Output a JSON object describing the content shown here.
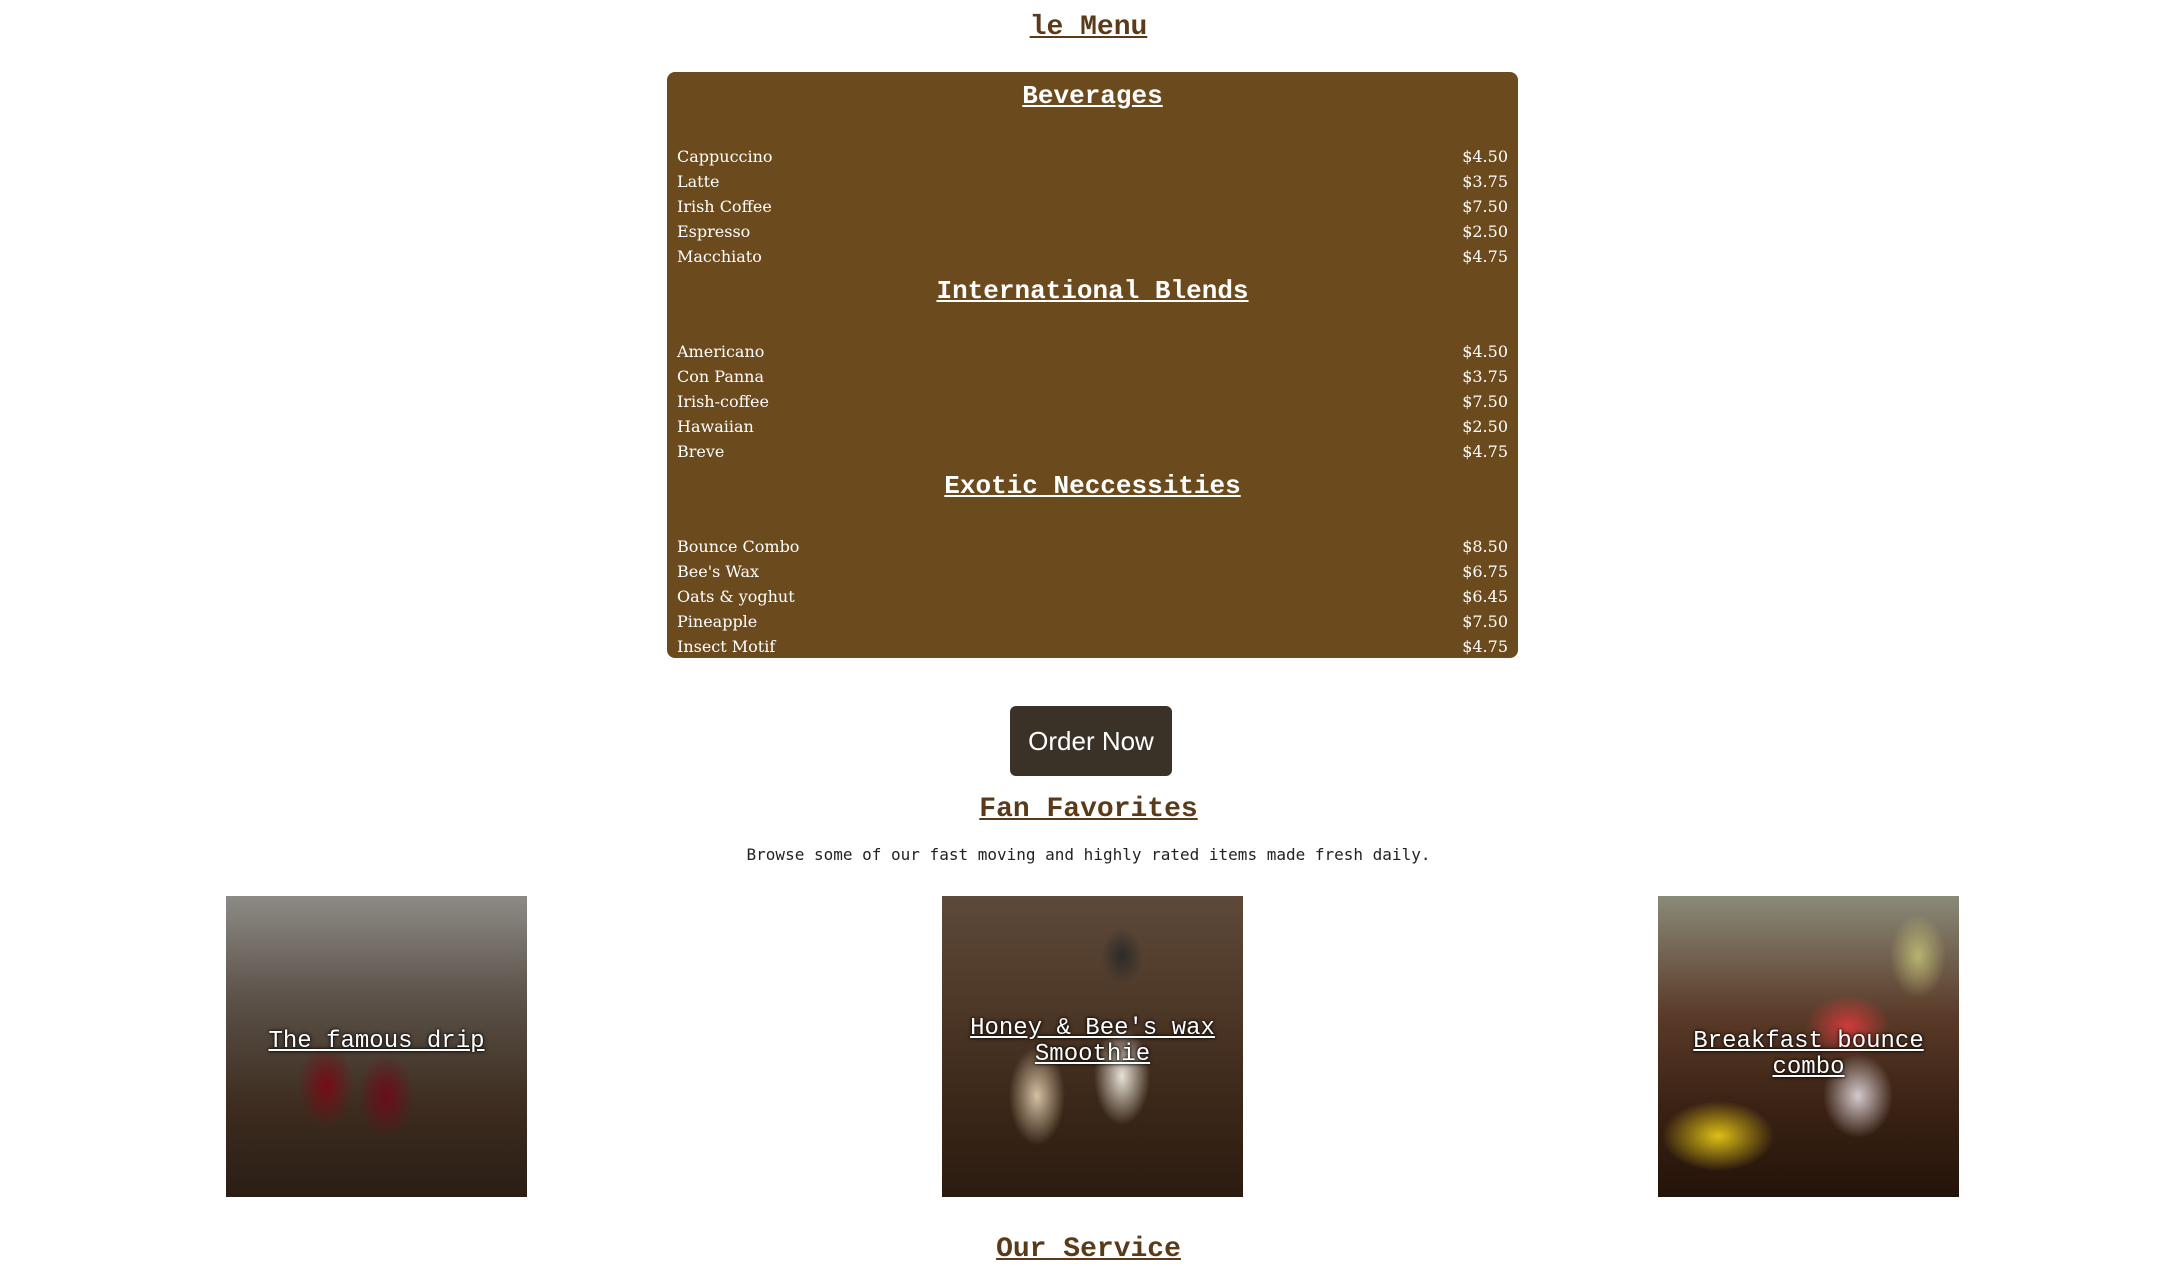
{
  "menu": {
    "heading": "le Menu",
    "categories": [
      {
        "title": "Beverages",
        "items": [
          {
            "name": "Cappuccino",
            "price": "$4.50"
          },
          {
            "name": "Latte",
            "price": "$3.75"
          },
          {
            "name": "Irish Coffee",
            "price": "$7.50"
          },
          {
            "name": "Espresso",
            "price": "$2.50"
          },
          {
            "name": "Macchiato",
            "price": "$4.75"
          }
        ]
      },
      {
        "title": "International Blends",
        "items": [
          {
            "name": "Americano",
            "price": "$4.50"
          },
          {
            "name": "Con Panna",
            "price": "$3.75"
          },
          {
            "name": "Irish-coffee",
            "price": "$7.50"
          },
          {
            "name": "Hawaiian",
            "price": "$2.50"
          },
          {
            "name": "Breve",
            "price": "$4.75"
          }
        ]
      },
      {
        "title": "Exotic Neccessities",
        "items": [
          {
            "name": "Bounce Combo",
            "price": "$8.50"
          },
          {
            "name": "Bee's Wax",
            "price": "$6.75"
          },
          {
            "name": "Oats & yoghut",
            "price": "$6.45"
          },
          {
            "name": "Pineapple",
            "price": "$7.50"
          },
          {
            "name": "Insect Motif",
            "price": "$4.75"
          }
        ]
      }
    ]
  },
  "order_button": {
    "label": "Order Now"
  },
  "fan_favorites": {
    "heading": "Fan Favorites",
    "subtitle": "Browse some of our fast moving and highly rated items made fresh daily.",
    "items": [
      {
        "caption": "The famous drip"
      },
      {
        "caption": "Honey & Bee's wax Smoothie"
      },
      {
        "caption": "Breakfast bounce combo"
      }
    ]
  },
  "service": {
    "heading": "Our Service"
  },
  "colors": {
    "menu_bg": "#6b4a1e",
    "heading_brown": "#5b3a1a",
    "button_bg": "#3a3227"
  }
}
